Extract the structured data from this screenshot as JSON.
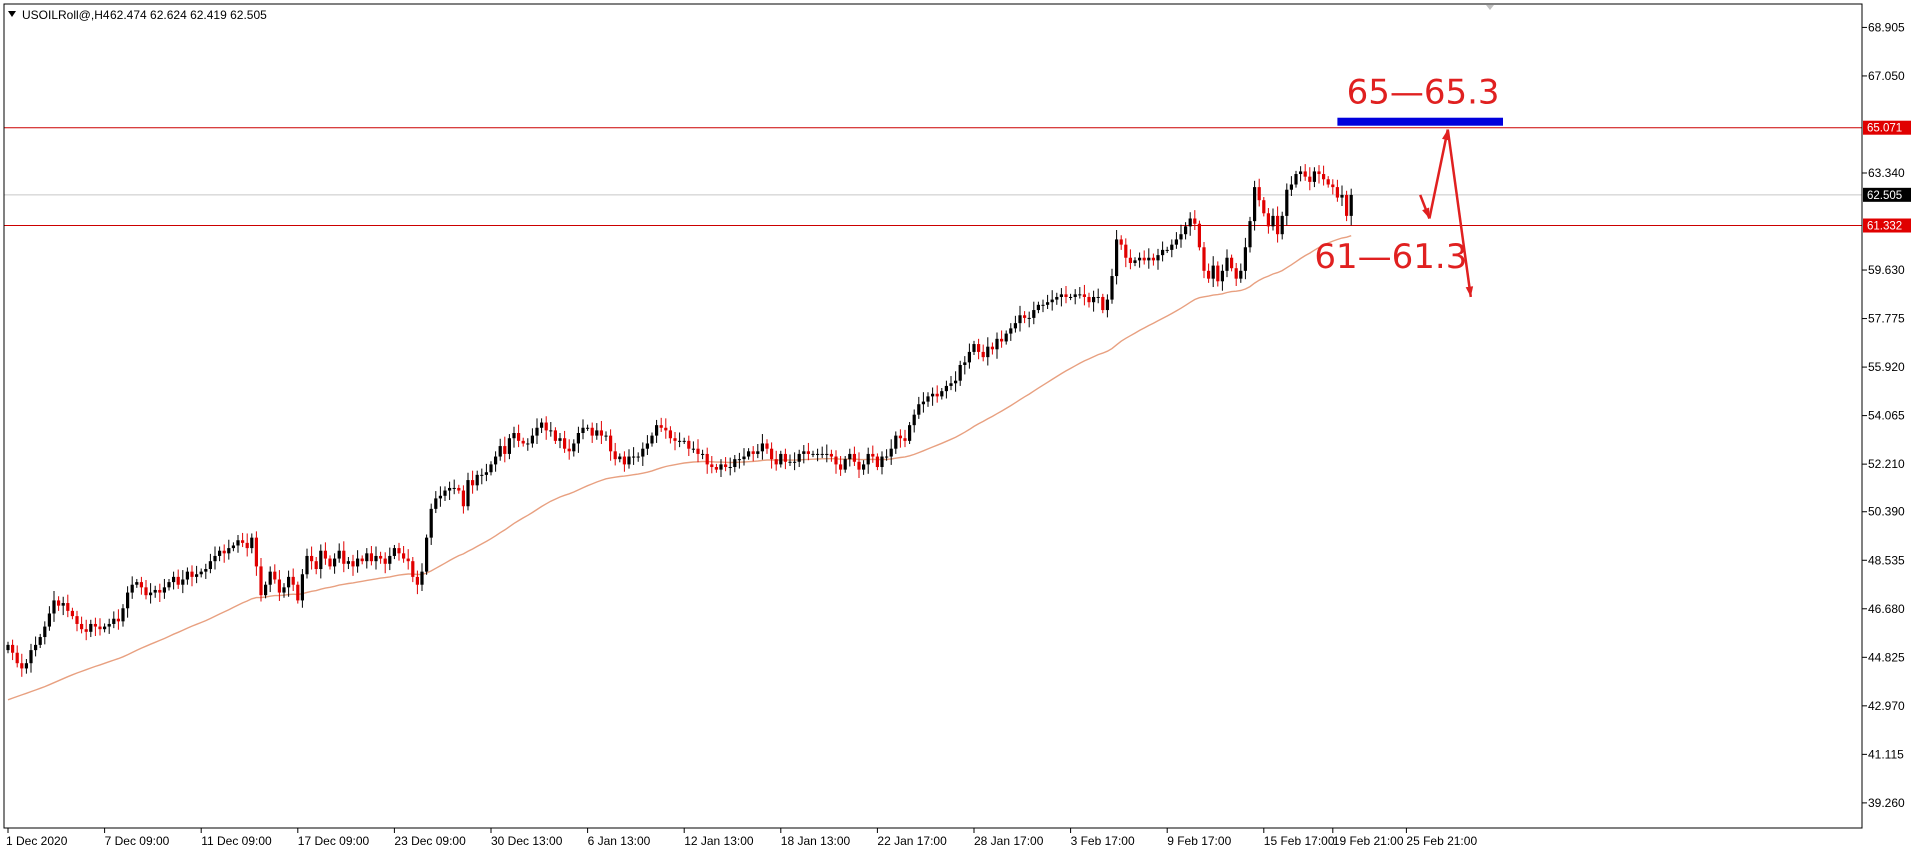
{
  "header": {
    "menu_icon": "triangle-down-icon",
    "symbol": "USOILRoll@,H4",
    "ohlc": "62.474 62.624 62.419 62.505"
  },
  "colors": {
    "bull": "#000000",
    "bear": "#e00000",
    "ma": "#e8a080",
    "support_resistance": "#cc0000",
    "current_price_line": "#c8c8c8",
    "zone_bar": "#0000dd",
    "annotation": "#e02020",
    "price_tag_red": "#e00000",
    "price_tag_black": "#000000"
  },
  "chart_data": {
    "type": "candlestick",
    "timeframe": "H4",
    "ylim": [
      38.3,
      69.8
    ],
    "y_ticks": [
      "68.905",
      "67.050",
      "63.340",
      "59.630",
      "57.775",
      "55.920",
      "54.065",
      "52.210",
      "50.390",
      "48.535",
      "46.680",
      "44.825",
      "42.970",
      "41.115",
      "39.260"
    ],
    "x_labels": [
      "1 Dec 2020",
      "7 Dec 09:00",
      "11 Dec 09:00",
      "17 Dec 09:00",
      "23 Dec 09:00",
      "30 Dec 13:00",
      "6 Jan 13:00",
      "12 Jan 13:00",
      "18 Jan 13:00",
      "22 Jan 17:00",
      "28 Jan 17:00",
      "3 Feb 17:00",
      "9 Feb 17:00",
      "15 Feb 17:00",
      "19 Feb 21:00",
      "25 Feb 21:00"
    ],
    "x_label_bars": [
      0,
      21,
      42,
      63,
      84,
      105,
      126,
      147,
      168,
      189,
      210,
      231,
      252,
      273,
      288,
      304
    ],
    "total_bars": 320,
    "closes": [
      45.3,
      45.0,
      44.6,
      44.4,
      44.6,
      45.1,
      45.3,
      45.6,
      46.0,
      46.5,
      47.0,
      46.8,
      46.9,
      46.6,
      46.4,
      46.1,
      45.9,
      45.8,
      46.1,
      46.0,
      45.9,
      46.0,
      46.1,
      46.3,
      46.2,
      46.7,
      47.3,
      47.6,
      47.7,
      47.5,
      47.2,
      47.3,
      47.4,
      47.3,
      47.5,
      47.7,
      47.9,
      47.6,
      47.8,
      48.1,
      47.9,
      48.0,
      48.1,
      48.2,
      48.5,
      48.7,
      48.9,
      48.8,
      49.0,
      49.1,
      49.3,
      49.2,
      49.0,
      49.4,
      48.3,
      47.2,
      47.6,
      48.1,
      47.8,
      47.3,
      47.5,
      47.9,
      47.6,
      47.0,
      48.0,
      48.7,
      48.5,
      48.2,
      48.9,
      48.6,
      48.3,
      48.6,
      48.9,
      48.4,
      48.5,
      48.3,
      48.6,
      48.5,
      48.8,
      48.5,
      48.7,
      48.6,
      48.4,
      48.7,
      49.0,
      48.8,
      48.6,
      48.5,
      47.9,
      47.6,
      48.1,
      49.4,
      50.5,
      50.9,
      51.0,
      51.2,
      51.3,
      51.3,
      51.2,
      50.6,
      51.6,
      51.4,
      51.8,
      51.8,
      51.9,
      52.2,
      52.5,
      52.9,
      52.6,
      53.2,
      53.4,
      53.1,
      53.0,
      53.0,
      53.3,
      53.6,
      53.8,
      53.5,
      53.5,
      53.1,
      53.2,
      52.8,
      52.7,
      53.0,
      53.4,
      53.6,
      53.6,
      53.3,
      53.5,
      53.3,
      53.3,
      52.7,
      52.4,
      52.5,
      52.2,
      52.5,
      52.5,
      52.5,
      52.8,
      53.0,
      53.3,
      53.7,
      53.6,
      53.5,
      53.2,
      53.1,
      53.1,
      53.1,
      52.8,
      52.8,
      52.6,
      52.6,
      52.2,
      52.1,
      52.0,
      52.2,
      52.1,
      52.1,
      52.4,
      52.4,
      52.5,
      52.7,
      52.6,
      52.7,
      53.0,
      52.8,
      52.4,
      52.2,
      52.6,
      52.3,
      52.3,
      52.3,
      52.6,
      52.7,
      52.6,
      52.6,
      52.6,
      52.6,
      52.6,
      52.5,
      52.2,
      52.0,
      52.4,
      52.6,
      52.3,
      52.0,
      52.2,
      52.6,
      52.5,
      52.1,
      52.5,
      52.5,
      52.8,
      53.3,
      53.2,
      53.1,
      53.7,
      54.1,
      54.5,
      54.6,
      54.8,
      54.9,
      54.8,
      55.0,
      55.2,
      55.3,
      55.4,
      56.0,
      56.1,
      56.5,
      56.8,
      56.5,
      56.3,
      56.7,
      56.6,
      57.0,
      56.9,
      57.2,
      57.4,
      57.6,
      57.9,
      57.8,
      57.8,
      58.1,
      58.3,
      58.3,
      58.4,
      58.5,
      58.6,
      58.7,
      58.6,
      58.6,
      58.7,
      58.7,
      58.6,
      58.4,
      58.6,
      58.6,
      58.1,
      58.5,
      59.4,
      60.8,
      60.6,
      60.1,
      59.9,
      60.0,
      60.1,
      60.0,
      60.1,
      60.0,
      60.2,
      60.4,
      60.4,
      60.6,
      60.8,
      61.0,
      61.3,
      61.6,
      61.4,
      60.5,
      59.6,
      59.3,
      59.8,
      59.2,
      59.6,
      60.1,
      59.7,
      59.3,
      59.6,
      60.5,
      61.5,
      62.8,
      62.3,
      61.8,
      61.3,
      61.7,
      61.0,
      61.7,
      62.7,
      62.9,
      63.3,
      63.4,
      63.2,
      63.0,
      63.4,
      63.3,
      63.1,
      62.9,
      62.8,
      62.4,
      62.5,
      61.7,
      62.5
    ],
    "ma_start": 43.2,
    "ma_end": 61.5,
    "hlines": [
      {
        "value": 65.071,
        "label": "65.071",
        "style": "red"
      },
      {
        "value": 62.505,
        "label": "62.505",
        "style": "current"
      },
      {
        "value": 61.332,
        "label": "61.332",
        "style": "red"
      }
    ],
    "zone": {
      "value": 65.3,
      "from_bar": 289,
      "to_bar": 325
    },
    "annotations": [
      {
        "text": "65—65.3",
        "bar": 291,
        "value": 66.0
      },
      {
        "text": "61—61.3",
        "bar": 284,
        "value": 59.7
      }
    ],
    "arrows": [
      {
        "from": [
          307,
          62.5
        ],
        "to": [
          309,
          61.6
        ]
      },
      {
        "from": [
          309,
          61.6
        ],
        "to": [
          313,
          65.0
        ]
      },
      {
        "from": [
          313,
          65.0
        ],
        "to": [
          318,
          58.6
        ]
      }
    ]
  }
}
